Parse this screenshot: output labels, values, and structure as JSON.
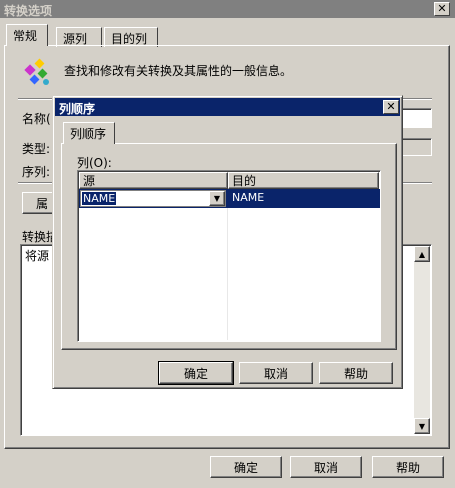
{
  "main_dialog": {
    "title": "转换选项",
    "tabs": [
      {
        "label": "常规"
      },
      {
        "label": "源列"
      },
      {
        "label": "目的列"
      }
    ],
    "description": "查找和修改有关转换及其属性的一般信息。",
    "name_label": "名称(",
    "type_label": "类型:",
    "sequence_label": "序列:",
    "button_partial_label": "属",
    "transform_label": "转换描",
    "transform_text": "将源",
    "buttons": {
      "ok": "确定",
      "cancel": "取消",
      "help": "帮助"
    }
  },
  "column_order_dialog": {
    "title": "列顺序",
    "tab": "列顺序",
    "columns_label": "列(O):",
    "grid": {
      "headers": [
        "源",
        "目的"
      ],
      "rows": [
        {
          "source": "NAME",
          "destination": "NAME"
        }
      ]
    },
    "buttons": {
      "ok": "确定",
      "cancel": "取消",
      "help": "帮助"
    }
  },
  "icons": {
    "close": "close-icon",
    "app": "transform-icon",
    "dropdown": "chevron-down-icon",
    "scroll_up": "arrow-up-icon",
    "scroll_down": "arrow-down-icon"
  },
  "colors": {
    "title_active": "#0a246a",
    "title_inactive": "#808080",
    "face": "#d4d0c8",
    "selection": "#0a246a"
  }
}
